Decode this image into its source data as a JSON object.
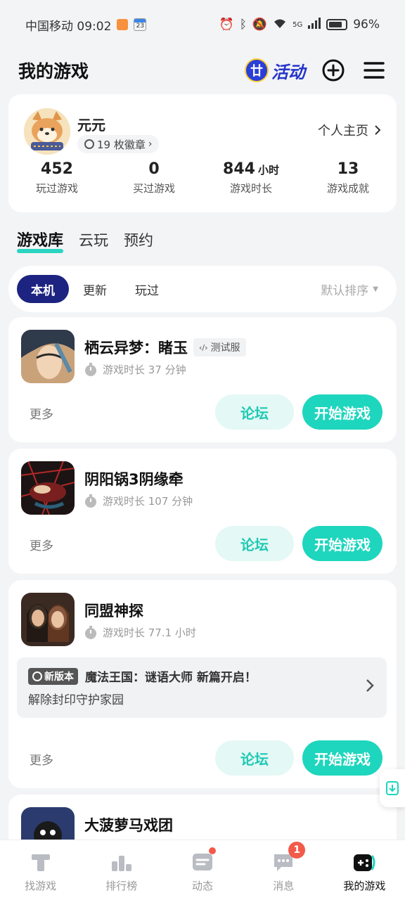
{
  "status_bar": {
    "carrier_time": "中国移动 09:02",
    "calendar_day": "23",
    "network": "5G",
    "battery": "96%"
  },
  "header": {
    "title": "我的游戏",
    "activity_label": "活动"
  },
  "profile": {
    "username": "元元",
    "badges": "19 枚徽章",
    "homepage_link": "个人主页",
    "stats": [
      {
        "value": "452",
        "unit": "",
        "label": "玩过游戏"
      },
      {
        "value": "0",
        "unit": "",
        "label": "买过游戏"
      },
      {
        "value": "844",
        "unit": "小时",
        "label": "游戏时长"
      },
      {
        "value": "13",
        "unit": "",
        "label": "游戏成就"
      }
    ]
  },
  "library_tabs": [
    "游戏库",
    "云玩",
    "预约"
  ],
  "filters": {
    "chips": [
      "本机",
      "更新",
      "玩过"
    ],
    "sort_label": "默认排序"
  },
  "games": [
    {
      "name": "栖云异梦：睹玉",
      "tag": "测试服",
      "playtime": "游戏时长 37 分钟",
      "more": "更多",
      "forum": "论坛",
      "play": "开始游戏"
    },
    {
      "name": "阴阳锅3阴缘牵",
      "playtime": "游戏时长 107 分钟",
      "more": "更多",
      "forum": "论坛",
      "play": "开始游戏"
    },
    {
      "name": "同盟神探",
      "playtime": "游戏时长 77.1 小时",
      "update_badge": "新版本",
      "update_title": "魔法王国：谜语大师 新篇开启！",
      "update_desc": "解除封印守护家园",
      "more": "更多",
      "forum": "论坛",
      "play": "开始游戏"
    },
    {
      "name": "大菠萝马戏团"
    }
  ],
  "bottom_nav": [
    {
      "label": "找游戏",
      "icon": "find-games-icon"
    },
    {
      "label": "排行榜",
      "icon": "ranking-icon"
    },
    {
      "label": "动态",
      "icon": "feed-icon"
    },
    {
      "label": "消息",
      "icon": "message-icon",
      "badge": "1"
    },
    {
      "label": "我的游戏",
      "icon": "gamepad-icon"
    }
  ],
  "colors": {
    "accent": "#1dd6bd",
    "accent_light": "#e4f8f5",
    "chip_active": "#1d2380",
    "badge_red": "#f35a4a"
  }
}
